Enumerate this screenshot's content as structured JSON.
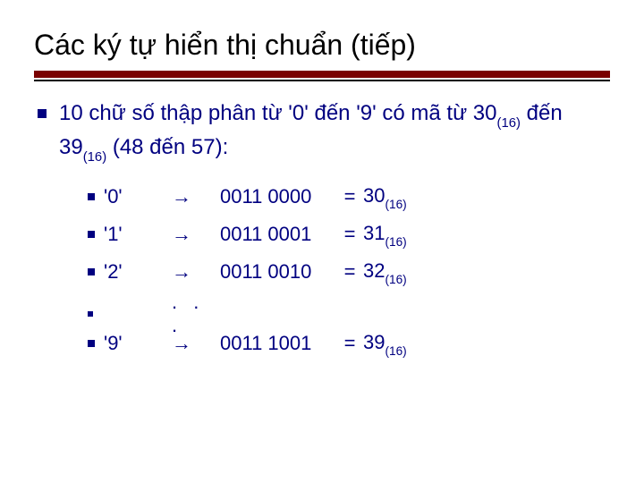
{
  "title": "Các ký tự hiển thị chuẩn (tiếp)",
  "lead": {
    "prefix": "10 chữ số thập phân từ '0' đến '9' có mã từ 30",
    "sub1": "(16)",
    "mid": " đến 39",
    "sub2": "(16)",
    "suffix": " (48 đến 57):"
  },
  "rows": [
    {
      "char": "'0'",
      "arrow": "→",
      "binary": "0011 0000",
      "eq": "=",
      "hex": "30",
      "hexsub": "(16)"
    },
    {
      "char": "'1'",
      "arrow": "→",
      "binary": "0011 0001",
      "eq": "=",
      "hex": "31",
      "hexsub": "(16)"
    },
    {
      "char": "'2'",
      "arrow": "→",
      "binary": "0011 0010",
      "eq": "=",
      "hex": "32",
      "hexsub": "(16)"
    }
  ],
  "ellipsis": ". . .",
  "lastRow": {
    "char": "'9'",
    "arrow": "→",
    "binary": "0011 1001",
    "eq": "=",
    "hex": "39",
    "hexsub": "(16)"
  }
}
